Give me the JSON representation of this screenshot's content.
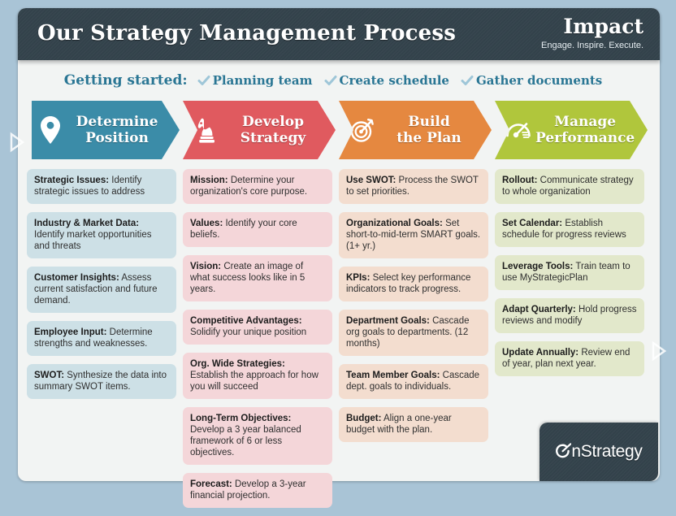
{
  "header": {
    "title": "Our Strategy Management Process",
    "brand_name": "Impact",
    "brand_tagline": "Engage. Inspire. Execute."
  },
  "getting_started": {
    "label": "Getting started:",
    "items": [
      {
        "label": "Planning team",
        "icon": "check-icon"
      },
      {
        "label": "Create schedule",
        "icon": "check-icon"
      },
      {
        "label": "Gather documents",
        "icon": "check-icon"
      }
    ]
  },
  "colors": {
    "frame": "#a9c4d6",
    "panel": "#f2f4f3",
    "dark_bar": "#33424b",
    "teal": "#3b8ca8",
    "red": "#e05a5f",
    "orange": "#e58840",
    "green": "#b0c63c",
    "accent_text": "#2a7694",
    "card_blue": "#cde0e6",
    "card_pink": "#f4d6d9",
    "card_peach": "#f3ddcf",
    "card_green": "#e2e8cb"
  },
  "columns": [
    {
      "id": "determine-position",
      "title": "Determine\nPosition",
      "title_line1": "Determine",
      "title_line2": "Position",
      "icon": "map-pin-icon",
      "color": "#3b8ca8",
      "card_color": "#cde0e6",
      "cards": [
        {
          "label": "Strategic Issues:",
          "text": "Identify strategic issues to address"
        },
        {
          "label": "Industry & Market Data:",
          "text": "Identify market opportunities and threats"
        },
        {
          "label": "Customer Insights:",
          "text": "Assess current satisfaction and future demand."
        },
        {
          "label": "Employee Input:",
          "text": "Determine strengths and weaknesses."
        },
        {
          "label": "SWOT:",
          "text": "Synthesize the data into summary SWOT items."
        }
      ]
    },
    {
      "id": "develop-strategy",
      "title_line1": "Develop",
      "title_line2": "Strategy",
      "icon": "chess-knight-icon",
      "color": "#e05a5f",
      "card_color": "#f4d6d9",
      "cards": [
        {
          "label": "Mission:",
          "text": "Determine your organization's core purpose."
        },
        {
          "label": "Values:",
          "text": "Identify your core beliefs."
        },
        {
          "label": "Vision:",
          "text": "Create an image of what success looks like in 5 years."
        },
        {
          "label": "Competitive Advantages:",
          "text": "Solidify your unique position"
        },
        {
          "label": "Org. Wide Strategies:",
          "text": "Establish the approach for how you will succeed"
        },
        {
          "label": "Long-Term Objectives:",
          "text": "Develop a 3 year balanced framework of 6 or less objectives."
        },
        {
          "label": "Forecast:",
          "text": "Develop a 3-year financial projection."
        }
      ]
    },
    {
      "id": "build-the-plan",
      "title_line1": "Build",
      "title_line2": "the Plan",
      "icon": "target-icon",
      "color": "#e58840",
      "card_color": "#f3ddcf",
      "cards": [
        {
          "label": "Use SWOT:",
          "text": "Process the SWOT to set priorities."
        },
        {
          "label": "Organizational Goals:",
          "text": "Set short-to-mid-term SMART goals. (1+ yr.)"
        },
        {
          "label": "KPIs:",
          "text": "Select key performance indicators to track progress."
        },
        {
          "label": "Department Goals:",
          "text": "Cascade org goals to departments. (12 months)"
        },
        {
          "label": "Team Member Goals:",
          "text": "Cascade dept. goals to individuals."
        },
        {
          "label": "Budget:",
          "text": "Align a one-year budget with the plan."
        }
      ]
    },
    {
      "id": "manage-performance",
      "title_line1": "Manage",
      "title_line2": "Performance",
      "icon": "gauge-icon",
      "color": "#b0c63c",
      "card_color": "#e2e8cb",
      "cards": [
        {
          "label": "Rollout:",
          "text": "Communicate strategy to whole organization"
        },
        {
          "label": "Set Calendar:",
          "text": "Establish schedule for progress reviews"
        },
        {
          "label": "Leverage Tools:",
          "text": "Train team to use MyStrategicPlan"
        },
        {
          "label": "Adapt Quarterly:",
          "text": "Hold progress reviews and modify"
        },
        {
          "label": "Update Annually:",
          "text": "Review end of year, plan next year."
        }
      ]
    }
  ],
  "footer": {
    "logo_text": "OnStrategy",
    "logo_first_letter": "O",
    "logo_rest": "nStrategy"
  }
}
